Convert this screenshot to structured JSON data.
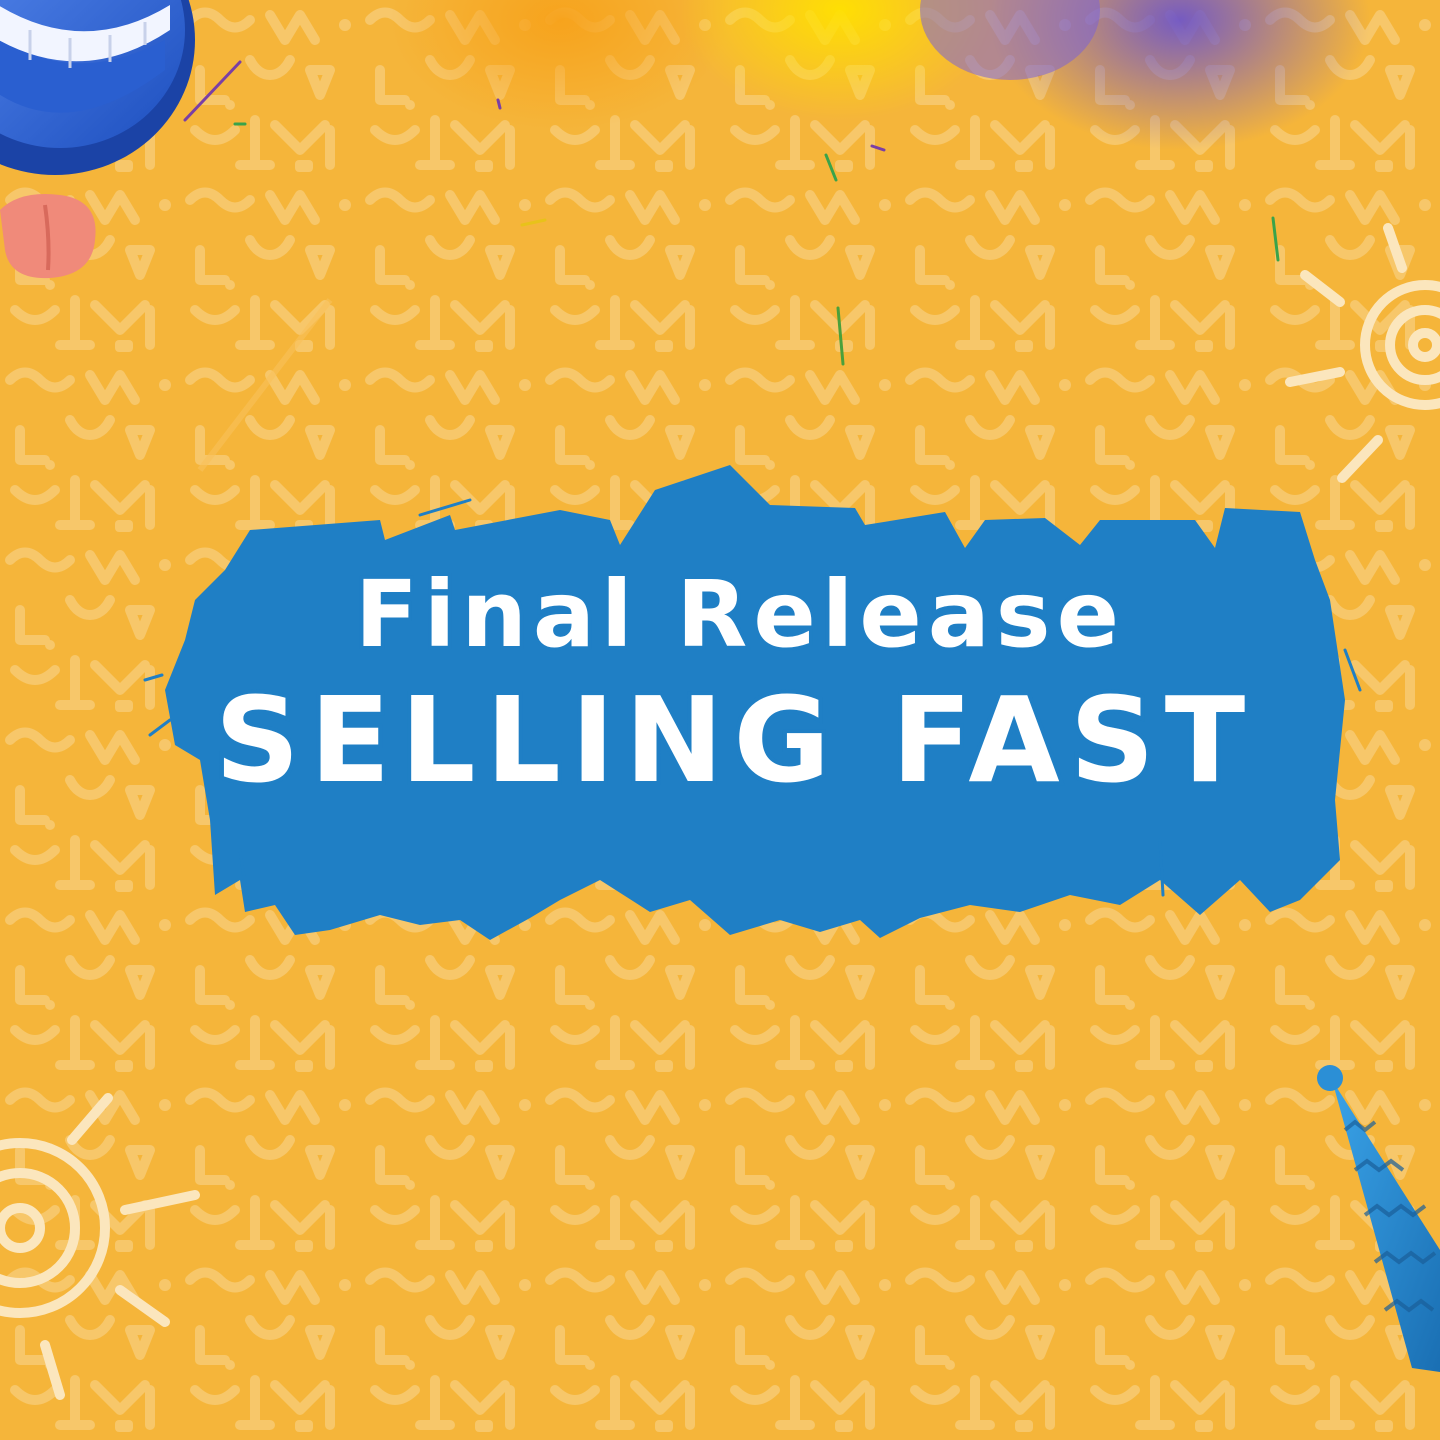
{
  "headline": {
    "line1": "Final Release",
    "line2": "SELLING FAST"
  },
  "colors": {
    "background": "#f5b53a",
    "pattern": "#f7c76a",
    "brush_stroke": "#1f7fc5",
    "text": "#ffffff",
    "sun_doodle": "#fbe6bd",
    "party_hat": "#2b8fd6"
  },
  "decorations": {
    "top_left": "cartoon-mouth-tongue-icon",
    "top_center": "blurred-balloons",
    "top_right": "sun-spiral-doodle-icon",
    "bottom_left": "sun-spiral-doodle-icon",
    "bottom_right": "party-hat-icon"
  }
}
